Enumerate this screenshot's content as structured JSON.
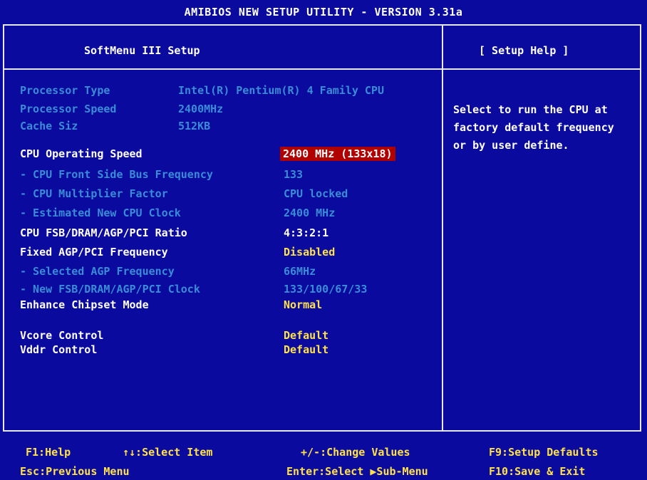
{
  "window": {
    "title": "AMIBIOS NEW SETUP UTILITY - VERSION 3.31a"
  },
  "left_panel": {
    "title": "SoftMenu III Setup"
  },
  "right_panel": {
    "title": "[ Setup Help ]",
    "help_text": "Select to run the CPU at factory default frequency or by user define."
  },
  "info": [
    {
      "label": "Processor Type",
      "value": "Intel(R) Pentium(R) 4 Family CPU"
    },
    {
      "label": "Processor Speed",
      "value": "2400MHz"
    },
    {
      "label": "Cache Siz",
      "value": "512KB"
    }
  ],
  "settings": [
    {
      "label": "CPU Operating Speed",
      "value": "2400 MHz (133x18)",
      "enabled": true,
      "selected": true
    },
    {
      "label": "- CPU Front Side Bus Frequency",
      "value": "133",
      "enabled": false
    },
    {
      "label": "- CPU Multiplier Factor",
      "value": "CPU locked",
      "enabled": false
    },
    {
      "label": "- Estimated New CPU Clock",
      "value": "2400 MHz",
      "enabled": false
    },
    {
      "label": "CPU FSB/DRAM/AGP/PCI Ratio",
      "value": "4:3:2:1",
      "enabled": true
    },
    {
      "label": "Fixed AGP/PCI Frequency",
      "value": "Disabled",
      "enabled": true
    },
    {
      "label": "- Selected AGP Frequency",
      "value": "66MHz",
      "enabled": false
    },
    {
      "label": "- New FSB/DRAM/AGP/PCI Clock",
      "value": "133/100/67/33",
      "enabled": false
    },
    {
      "label": "Enhance Chipset Mode",
      "value": "Normal",
      "enabled": true
    },
    {
      "label": "Vcore Control",
      "value": "Default",
      "enabled": true
    },
    {
      "label": "Vddr Control",
      "value": "Default",
      "enabled": true
    }
  ],
  "footer": {
    "f1": "F1:Help",
    "select_item": "↑↓:Select Item",
    "change_values": "+/-:Change Values",
    "setup_defaults": "F9:Setup Defaults",
    "esc": "Esc:Previous Menu",
    "enter": "Enter:Select ▶Sub-Menu",
    "save_exit": "F10:Save & Exit"
  },
  "colors": {
    "background": "#0a0a9e",
    "dimmed": "#3a8cd6",
    "value": "#ffe14a",
    "selected_bg": "#b00000"
  }
}
